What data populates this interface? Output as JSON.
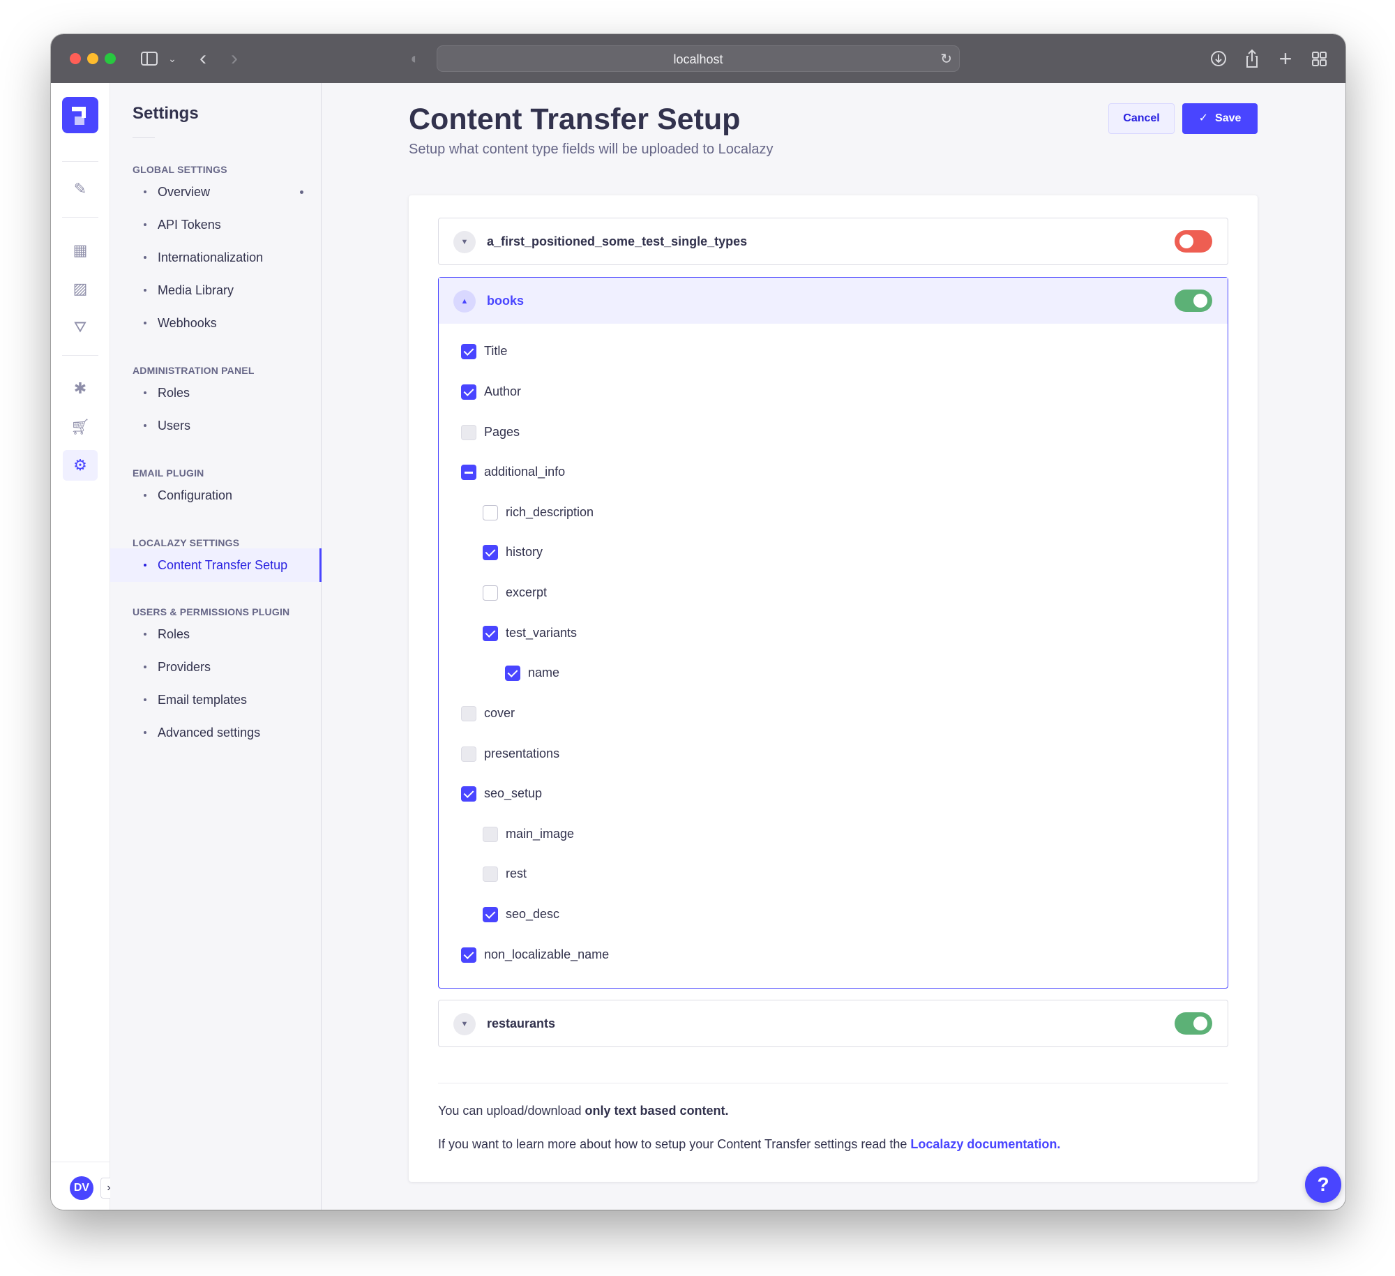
{
  "browser": {
    "url": "localhost"
  },
  "subnav": {
    "title": "Settings",
    "sections": {
      "global": {
        "title": "GLOBAL SETTINGS",
        "items": [
          "Overview",
          "API Tokens",
          "Internationalization",
          "Media Library",
          "Webhooks"
        ]
      },
      "admin": {
        "title": "ADMINISTRATION PANEL",
        "items": [
          "Roles",
          "Users"
        ]
      },
      "email": {
        "title": "EMAIL PLUGIN",
        "items": [
          "Configuration"
        ]
      },
      "localazy": {
        "title": "LOCALAZY SETTINGS",
        "items": [
          "Content Transfer Setup"
        ]
      },
      "users_permissions": {
        "title": "USERS & PERMISSIONS PLUGIN",
        "items": [
          "Roles",
          "Providers",
          "Email templates",
          "Advanced settings"
        ]
      }
    }
  },
  "page": {
    "title": "Content Transfer Setup",
    "subtitle": "Setup what content type fields will be uploaded to Localazy",
    "cancel_label": "Cancel",
    "save_label": "Save"
  },
  "content_types": [
    {
      "name": "a_first_positioned_some_test_single_types",
      "enabled": false,
      "expanded": false
    },
    {
      "name": "books",
      "enabled": true,
      "expanded": true,
      "fields": [
        {
          "label": "Title",
          "state": "checked",
          "level": 0
        },
        {
          "label": "Author",
          "state": "checked",
          "level": 0
        },
        {
          "label": "Pages",
          "state": "disabled",
          "level": 0
        },
        {
          "label": "additional_info",
          "state": "indeterminate",
          "level": 0
        },
        {
          "label": "rich_description",
          "state": "unchecked",
          "level": 1
        },
        {
          "label": "history",
          "state": "checked",
          "level": 1
        },
        {
          "label": "excerpt",
          "state": "unchecked",
          "level": 1
        },
        {
          "label": "test_variants",
          "state": "checked",
          "level": 1
        },
        {
          "label": "name",
          "state": "checked",
          "level": 2
        },
        {
          "label": "cover",
          "state": "disabled",
          "level": 0
        },
        {
          "label": "presentations",
          "state": "disabled",
          "level": 0
        },
        {
          "label": "seo_setup",
          "state": "checked",
          "level": 0
        },
        {
          "label": "main_image",
          "state": "disabled",
          "level": 1
        },
        {
          "label": "rest",
          "state": "disabled",
          "level": 1
        },
        {
          "label": "seo_desc",
          "state": "checked",
          "level": 1
        },
        {
          "label": "non_localizable_name",
          "state": "checked",
          "level": 0
        }
      ]
    },
    {
      "name": "restaurants",
      "enabled": true,
      "expanded": false
    }
  ],
  "info": {
    "line1_prefix": "You can upload/download ",
    "line1_bold": "only text based content.",
    "line2_prefix": "If you want to learn more about how to setup your Content Transfer settings read the ",
    "line2_link": "Localazy documentation."
  },
  "user": {
    "initials": "DV"
  },
  "help": {
    "label": "?"
  },
  "colors": {
    "primary": "#4945ff",
    "toggle_on": "#5cb176",
    "toggle_off": "#ee5e52"
  }
}
